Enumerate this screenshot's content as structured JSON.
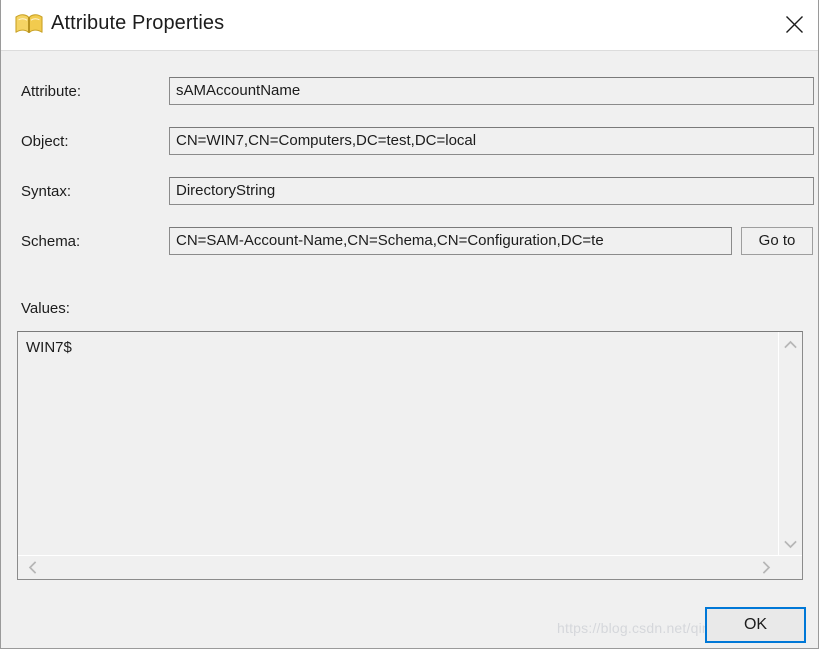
{
  "window": {
    "title": "Attribute Properties",
    "icon": "open-book-icon",
    "close_label": "×",
    "background_color": "#f0f0f0",
    "titlebar_color": "#ffffff"
  },
  "fields": [
    {
      "label": "Attribute:",
      "value": "sAMAccountName"
    },
    {
      "label": "Object:",
      "value": "CN=WIN7,CN=Computers,DC=test,DC=local"
    },
    {
      "label": "Syntax:",
      "value": "DirectoryString"
    },
    {
      "label": "Schema:",
      "value": "CN=SAM-Account-Name,CN=Schema,CN=Configuration,DC=te"
    }
  ],
  "goto_button": {
    "label": "Go to"
  },
  "values": {
    "label": "Values:",
    "content": "WIN7$",
    "vertical_scrollbar": {
      "up_icon": "chevron-up-icon",
      "down_icon": "chevron-down-icon"
    },
    "horizontal_scrollbar": {
      "left_icon": "chevron-left-icon",
      "right_icon": "chevron-right-icon"
    }
  },
  "footer": {
    "ok_label": "OK",
    "ok_focus_color": "#0078d7"
  },
  "watermark": {
    "text": "https://blog.csdn.net/qingzutianxia"
  }
}
